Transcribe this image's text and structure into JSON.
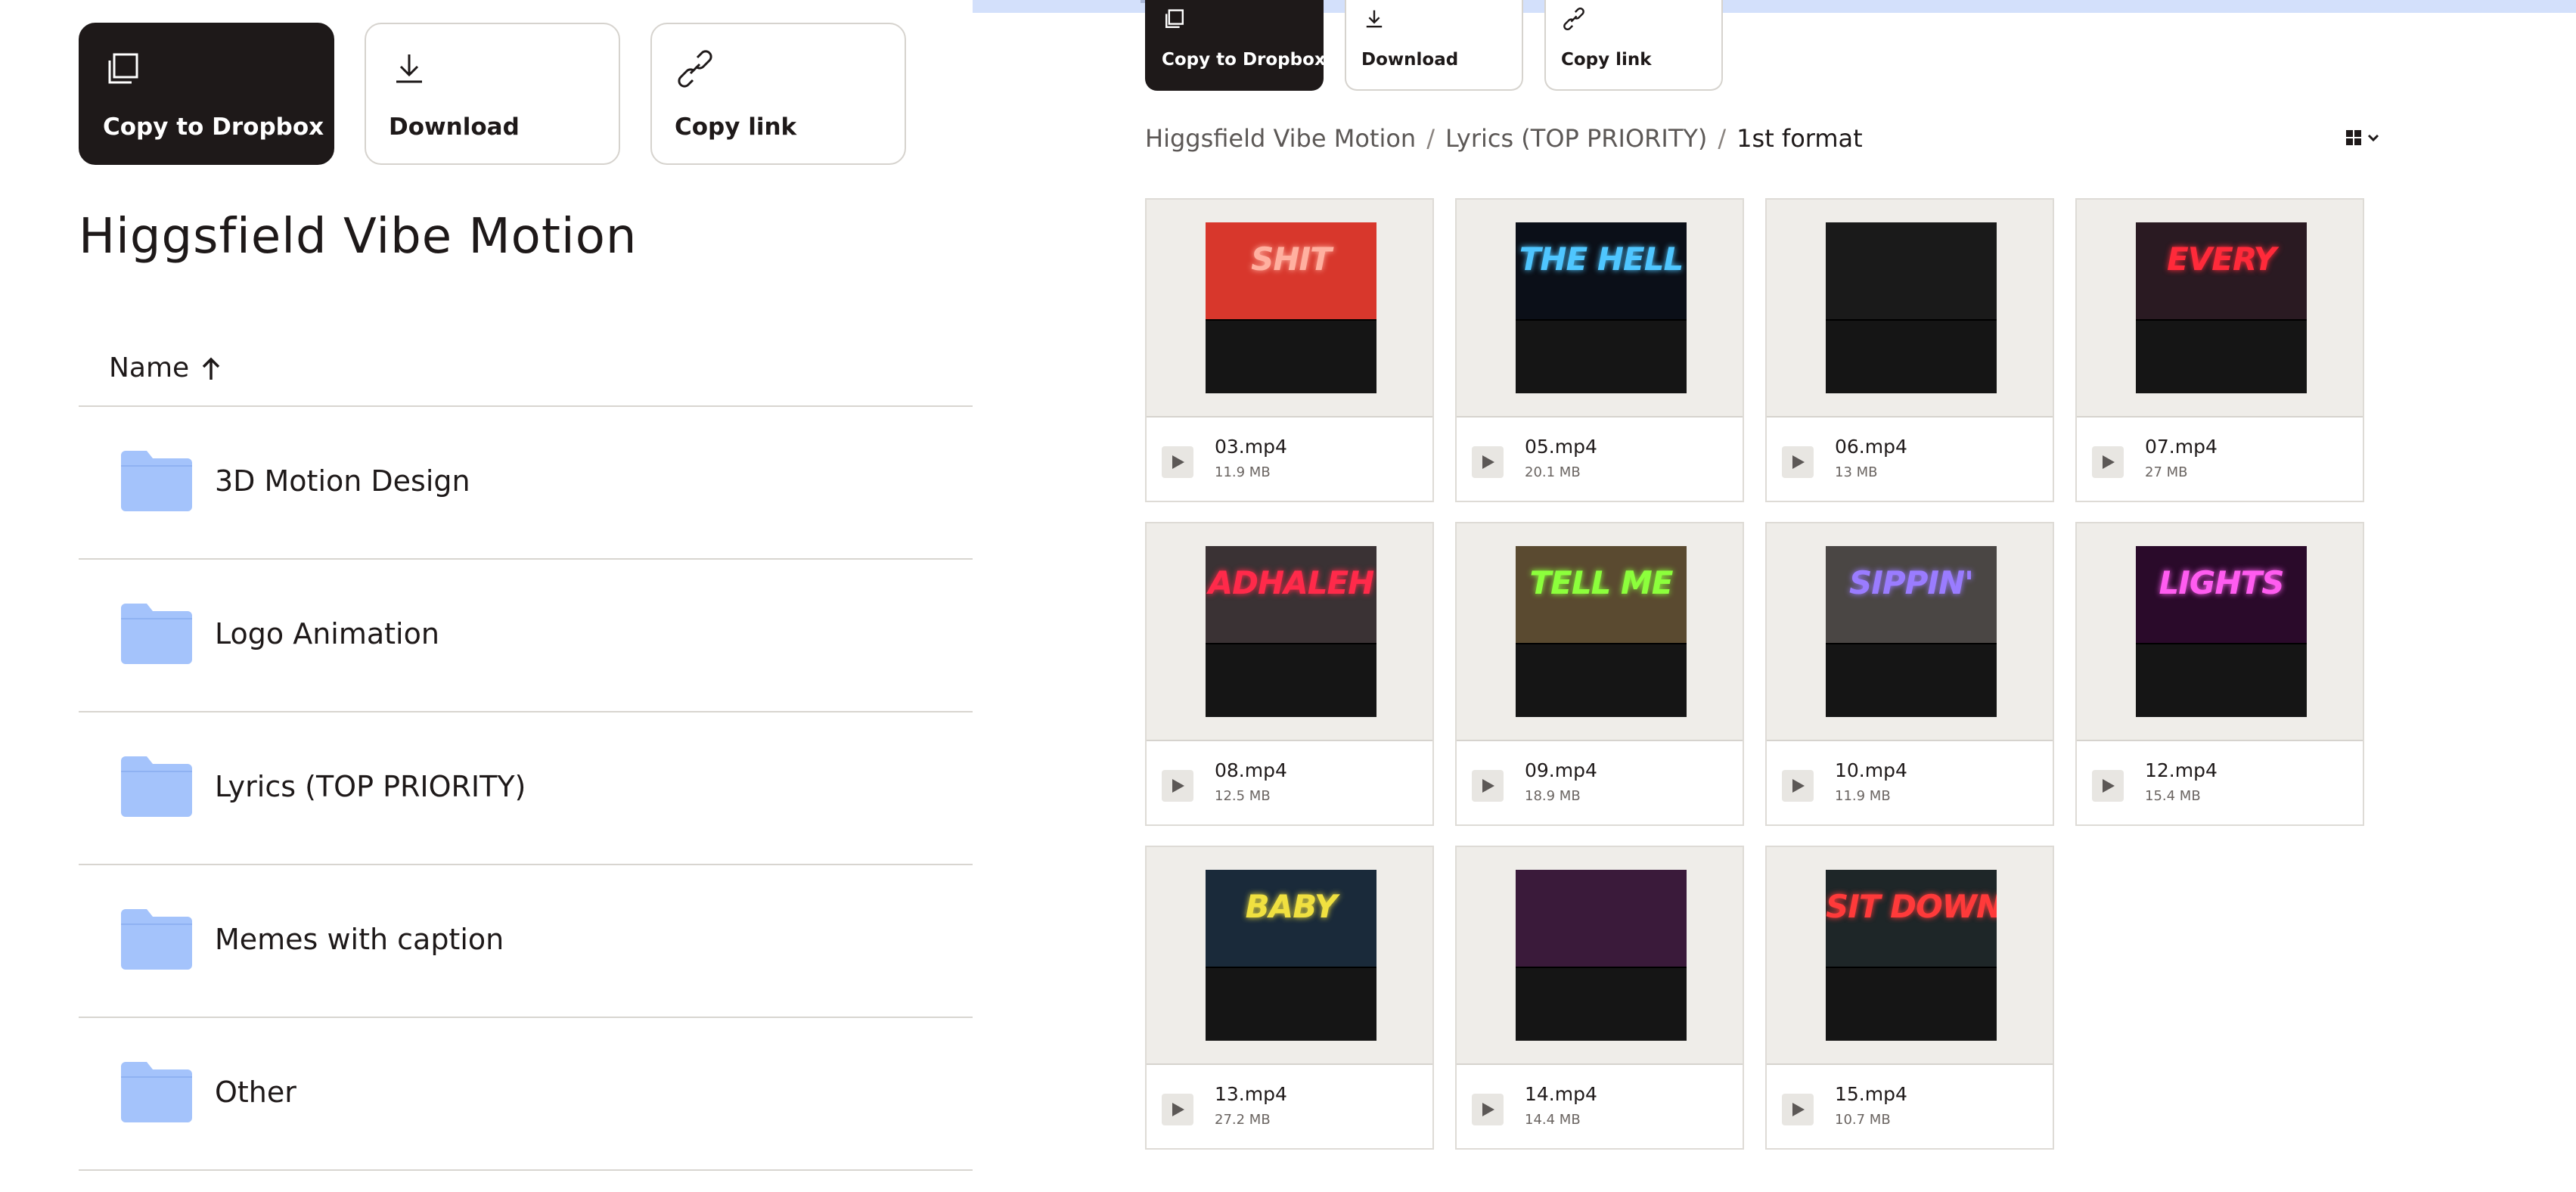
{
  "left_panel": {
    "actions": [
      {
        "label": "Copy to Dropbox",
        "icon": "copy-icon"
      },
      {
        "label": "Download",
        "icon": "download-icon"
      },
      {
        "label": "Copy link",
        "icon": "link-icon"
      }
    ],
    "title": "Higgsfield Vibe Motion",
    "column_header": "Name",
    "sort_icon": "arrow-up-icon",
    "folders": [
      {
        "name": "3D Motion Design"
      },
      {
        "name": "Logo Animation"
      },
      {
        "name": "Lyrics (TOP PRIORITY)"
      },
      {
        "name": "Memes with caption"
      },
      {
        "name": "Other"
      }
    ]
  },
  "right_panel": {
    "actions": [
      {
        "label": "Copy to Dropbox",
        "icon": "copy-icon"
      },
      {
        "label": "Download",
        "icon": "download-icon"
      },
      {
        "label": "Copy link",
        "icon": "link-icon"
      }
    ],
    "breadcrumb": [
      "Higgsfield Vibe Motion",
      "Lyrics (TOP PRIORITY)",
      "1st format"
    ],
    "view_toggle_icon": "grid-view-icon",
    "files": [
      {
        "name": "03.mp4",
        "size": "11.9 MB",
        "thumb_text": "SHIT",
        "thumb_color": "#d8372c",
        "text_color": "#ffb0a0"
      },
      {
        "name": "05.mp4",
        "size": "20.1 MB",
        "thumb_text": "THE HELL",
        "thumb_color": "#0b0f18",
        "text_color": "#4fc6ff"
      },
      {
        "name": "06.mp4",
        "size": "13 MB",
        "thumb_text": "",
        "thumb_color": "#1a1a1a",
        "text_color": "#888888"
      },
      {
        "name": "07.mp4",
        "size": "27 MB",
        "thumb_text": "EVERY",
        "thumb_color": "#2a1a22",
        "text_color": "#ff2a3a"
      },
      {
        "name": "08.mp4",
        "size": "12.5 MB",
        "thumb_text": "ADHALEH",
        "thumb_color": "#3a3234",
        "text_color": "#ff2a4a"
      },
      {
        "name": "09.mp4",
        "size": "18.9 MB",
        "thumb_text": "TELL ME",
        "thumb_color": "#5a4a30",
        "text_color": "#8cff3c"
      },
      {
        "name": "10.mp4",
        "size": "11.9 MB",
        "thumb_text": "SIPPIN'",
        "thumb_color": "#4a4644",
        "text_color": "#9a7cff"
      },
      {
        "name": "12.mp4",
        "size": "15.4 MB",
        "thumb_text": "LIGHTS",
        "thumb_color": "#2a0a2a",
        "text_color": "#ff5cf0"
      },
      {
        "name": "13.mp4",
        "size": "27.2 MB",
        "thumb_text": "BABY",
        "thumb_color": "#1a2a3a",
        "text_color": "#f0e040"
      },
      {
        "name": "14.mp4",
        "size": "14.4 MB",
        "thumb_text": "",
        "thumb_color": "#3a1a3a",
        "text_color": "#ff3a5a"
      },
      {
        "name": "15.mp4",
        "size": "10.7 MB",
        "thumb_text": "SIT DOWN",
        "thumb_color": "#1e2628",
        "text_color": "#ff3a3a"
      }
    ]
  },
  "colors": {
    "primary_dark": "#1e1919",
    "folder_blue": "#a4c3fb",
    "topbar": "#d3e0fb",
    "thumb_bg": "#efede9"
  }
}
